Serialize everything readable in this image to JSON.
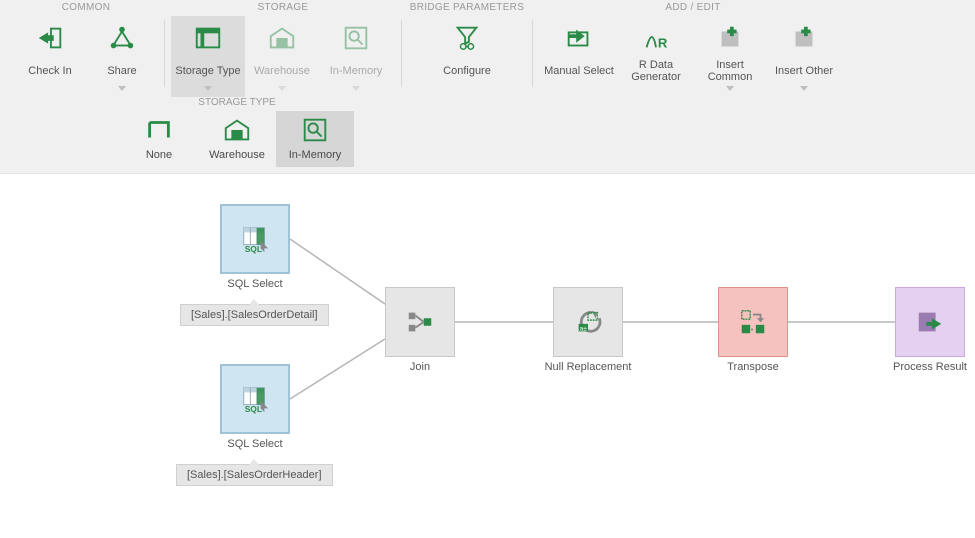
{
  "ribbon": {
    "groups": {
      "common": {
        "title": "COMMON",
        "checkIn": "Check In",
        "share": "Share"
      },
      "storage": {
        "title": "STORAGE",
        "storageType": "Storage Type",
        "warehouse": "Warehouse",
        "inMemory": "In-Memory"
      },
      "bridge": {
        "title": "BRIDGE PARAMETERS",
        "configure": "Configure"
      },
      "addedit": {
        "title": "ADD / EDIT",
        "manualSelect": "Manual Select",
        "rDataGen": "R Data\nGenerator",
        "insertCommon": "Insert\nCommon",
        "insertOther": "Insert Other"
      }
    },
    "storageTypeRow": {
      "title": "STORAGE TYPE",
      "none": "None",
      "warehouse": "Warehouse",
      "inMemory": "In-Memory"
    }
  },
  "colors": {
    "accent": "#2a8a47"
  },
  "flow": {
    "nodes": {
      "sql1": {
        "label": "SQL Select",
        "tableRef": "[Sales].[SalesOrderDetail]"
      },
      "sql2": {
        "label": "SQL Select",
        "tableRef": "[Sales].[SalesOrderHeader]"
      },
      "join": {
        "label": "Join"
      },
      "nullrep": {
        "label": "Null Replacement"
      },
      "transpose": {
        "label": "Transpose"
      },
      "result": {
        "label": "Process Result"
      }
    }
  }
}
